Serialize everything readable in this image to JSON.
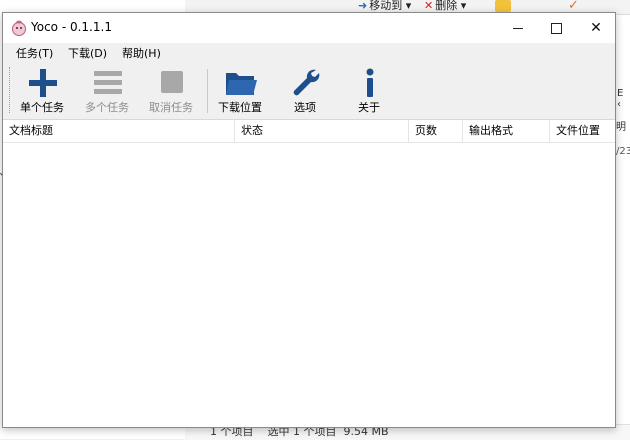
{
  "background_app": {
    "move_label": "移动到",
    "delete_label": "删除",
    "right_texts": [
      "E ‹",
      "明",
      "/23"
    ],
    "left_text": "Y",
    "status_text": "1 个项目    选中 1 个项目  9.54 MB"
  },
  "window": {
    "title": "Yoco - 0.1.1.1",
    "controls": {
      "close": "✕"
    }
  },
  "menu": [
    {
      "label": "任务(T)"
    },
    {
      "label": "下载(D)"
    },
    {
      "label": "帮助(H)"
    }
  ],
  "toolbar": [
    {
      "label": "单个任务",
      "icon": "plus-icon",
      "enabled": true
    },
    {
      "label": "多个任务",
      "icon": "list-icon",
      "enabled": false
    },
    {
      "label": "取消任务",
      "icon": "stop-icon",
      "enabled": false
    },
    {
      "label": "下载位置",
      "icon": "folder-icon",
      "enabled": true
    },
    {
      "label": "选项",
      "icon": "wrench-icon",
      "enabled": true
    },
    {
      "label": "关于",
      "icon": "info-icon",
      "enabled": true
    }
  ],
  "table": {
    "columns": [
      "文档标题",
      "状态",
      "页数",
      "输出格式",
      "文件位置"
    ],
    "rows": []
  },
  "colors": {
    "icon_blue": "#1f4e8c",
    "icon_disabled": "#a8a8a8"
  }
}
